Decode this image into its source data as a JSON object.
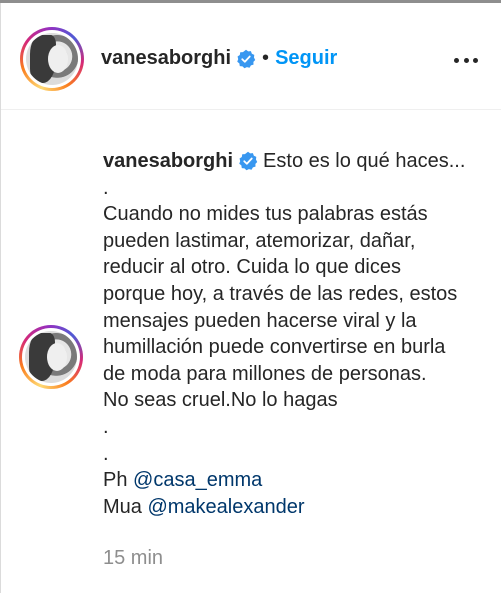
{
  "header": {
    "username": "vanesaborghi",
    "separator": "•",
    "follow_label": "Seguir",
    "avatar_icon": "profile-photo-avatar",
    "more_icon": "more-options-icon"
  },
  "caption": {
    "username": "vanesaborghi",
    "first_line": "Esto es lo qué haces...",
    "lines": [
      ".",
      "Cuando no mides tus palabras estás",
      "pueden lastimar, atemorizar, dañar,",
      "reducir al otro. Cuida lo que dices",
      "porque hoy, a través de las redes, estos",
      "mensajes pueden hacerse viral y la",
      "humillación puede convertirse en burla",
      "de moda para millones de personas.",
      "No seas cruel.No lo hagas",
      ".",
      "."
    ],
    "credits": [
      {
        "prefix": "Ph ",
        "mention": "@casa_emma"
      },
      {
        "prefix": "Mua ",
        "mention": "@makealexander"
      }
    ],
    "timestamp": "15 min"
  },
  "colors": {
    "text": "#262626",
    "link_blue": "#0095f6",
    "mention": "#00376b",
    "muted": "#8e8e8e",
    "verified_blue": "#3897f0"
  }
}
